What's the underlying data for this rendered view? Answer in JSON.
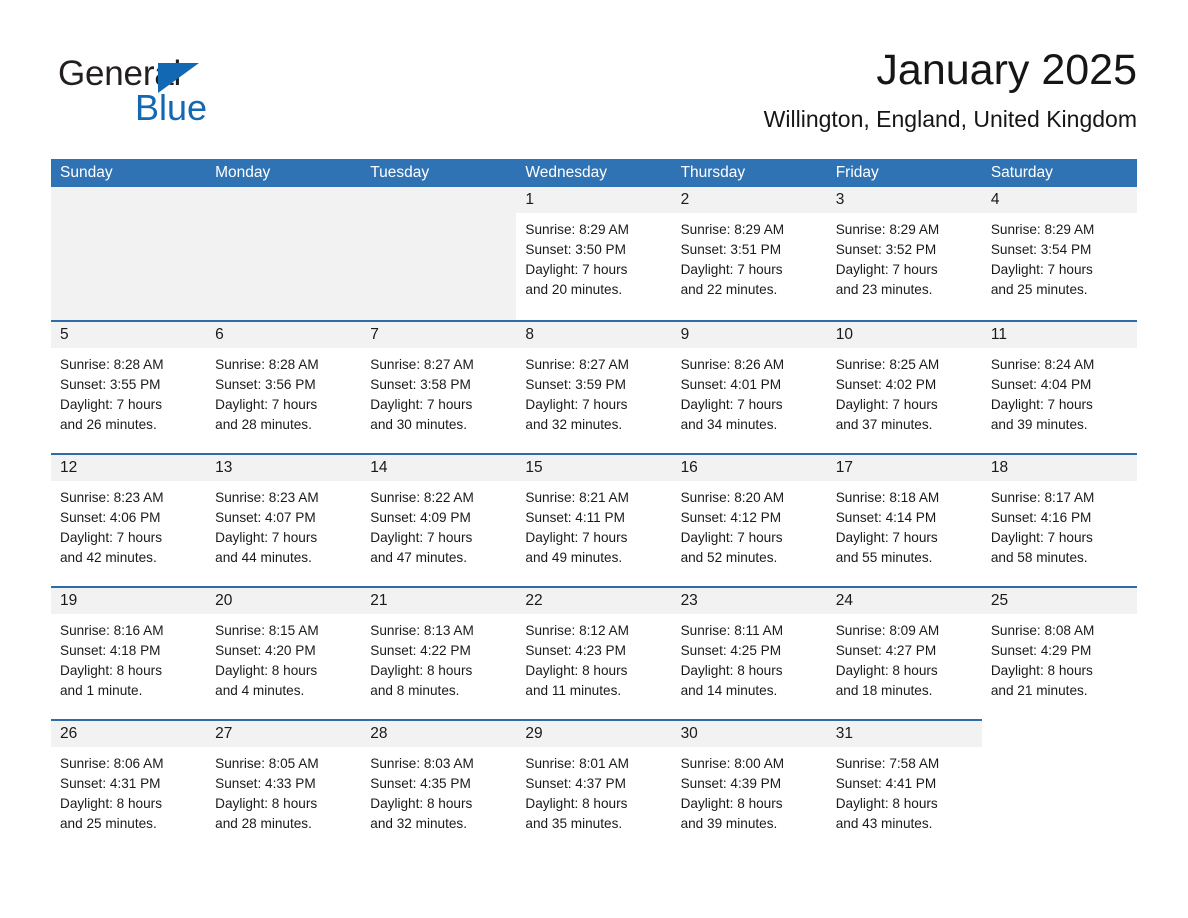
{
  "brand": {
    "name_part1": "General",
    "name_part2": "Blue",
    "accent_color": "#1268b3"
  },
  "header": {
    "month_title": "January 2025",
    "location": "Willington, England, United Kingdom"
  },
  "theme": {
    "header_row_bg": "#3073b5",
    "week_divider": "#2e6ca8",
    "day_band_bg": "#f2f2f2"
  },
  "weekdays": [
    "Sunday",
    "Monday",
    "Tuesday",
    "Wednesday",
    "Thursday",
    "Friday",
    "Saturday"
  ],
  "weeks": [
    [
      {
        "empty": true
      },
      {
        "empty": true
      },
      {
        "empty": true
      },
      {
        "day": "1",
        "sunrise": "Sunrise: 8:29 AM",
        "sunset": "Sunset: 3:50 PM",
        "daylight1": "Daylight: 7 hours",
        "daylight2": "and 20 minutes."
      },
      {
        "day": "2",
        "sunrise": "Sunrise: 8:29 AM",
        "sunset": "Sunset: 3:51 PM",
        "daylight1": "Daylight: 7 hours",
        "daylight2": "and 22 minutes."
      },
      {
        "day": "3",
        "sunrise": "Sunrise: 8:29 AM",
        "sunset": "Sunset: 3:52 PM",
        "daylight1": "Daylight: 7 hours",
        "daylight2": "and 23 minutes."
      },
      {
        "day": "4",
        "sunrise": "Sunrise: 8:29 AM",
        "sunset": "Sunset: 3:54 PM",
        "daylight1": "Daylight: 7 hours",
        "daylight2": "and 25 minutes."
      }
    ],
    [
      {
        "day": "5",
        "sunrise": "Sunrise: 8:28 AM",
        "sunset": "Sunset: 3:55 PM",
        "daylight1": "Daylight: 7 hours",
        "daylight2": "and 26 minutes."
      },
      {
        "day": "6",
        "sunrise": "Sunrise: 8:28 AM",
        "sunset": "Sunset: 3:56 PM",
        "daylight1": "Daylight: 7 hours",
        "daylight2": "and 28 minutes."
      },
      {
        "day": "7",
        "sunrise": "Sunrise: 8:27 AM",
        "sunset": "Sunset: 3:58 PM",
        "daylight1": "Daylight: 7 hours",
        "daylight2": "and 30 minutes."
      },
      {
        "day": "8",
        "sunrise": "Sunrise: 8:27 AM",
        "sunset": "Sunset: 3:59 PM",
        "daylight1": "Daylight: 7 hours",
        "daylight2": "and 32 minutes."
      },
      {
        "day": "9",
        "sunrise": "Sunrise: 8:26 AM",
        "sunset": "Sunset: 4:01 PM",
        "daylight1": "Daylight: 7 hours",
        "daylight2": "and 34 minutes."
      },
      {
        "day": "10",
        "sunrise": "Sunrise: 8:25 AM",
        "sunset": "Sunset: 4:02 PM",
        "daylight1": "Daylight: 7 hours",
        "daylight2": "and 37 minutes."
      },
      {
        "day": "11",
        "sunrise": "Sunrise: 8:24 AM",
        "sunset": "Sunset: 4:04 PM",
        "daylight1": "Daylight: 7 hours",
        "daylight2": "and 39 minutes."
      }
    ],
    [
      {
        "day": "12",
        "sunrise": "Sunrise: 8:23 AM",
        "sunset": "Sunset: 4:06 PM",
        "daylight1": "Daylight: 7 hours",
        "daylight2": "and 42 minutes."
      },
      {
        "day": "13",
        "sunrise": "Sunrise: 8:23 AM",
        "sunset": "Sunset: 4:07 PM",
        "daylight1": "Daylight: 7 hours",
        "daylight2": "and 44 minutes."
      },
      {
        "day": "14",
        "sunrise": "Sunrise: 8:22 AM",
        "sunset": "Sunset: 4:09 PM",
        "daylight1": "Daylight: 7 hours",
        "daylight2": "and 47 minutes."
      },
      {
        "day": "15",
        "sunrise": "Sunrise: 8:21 AM",
        "sunset": "Sunset: 4:11 PM",
        "daylight1": "Daylight: 7 hours",
        "daylight2": "and 49 minutes."
      },
      {
        "day": "16",
        "sunrise": "Sunrise: 8:20 AM",
        "sunset": "Sunset: 4:12 PM",
        "daylight1": "Daylight: 7 hours",
        "daylight2": "and 52 minutes."
      },
      {
        "day": "17",
        "sunrise": "Sunrise: 8:18 AM",
        "sunset": "Sunset: 4:14 PM",
        "daylight1": "Daylight: 7 hours",
        "daylight2": "and 55 minutes."
      },
      {
        "day": "18",
        "sunrise": "Sunrise: 8:17 AM",
        "sunset": "Sunset: 4:16 PM",
        "daylight1": "Daylight: 7 hours",
        "daylight2": "and 58 minutes."
      }
    ],
    [
      {
        "day": "19",
        "sunrise": "Sunrise: 8:16 AM",
        "sunset": "Sunset: 4:18 PM",
        "daylight1": "Daylight: 8 hours",
        "daylight2": "and 1 minute."
      },
      {
        "day": "20",
        "sunrise": "Sunrise: 8:15 AM",
        "sunset": "Sunset: 4:20 PM",
        "daylight1": "Daylight: 8 hours",
        "daylight2": "and 4 minutes."
      },
      {
        "day": "21",
        "sunrise": "Sunrise: 8:13 AM",
        "sunset": "Sunset: 4:22 PM",
        "daylight1": "Daylight: 8 hours",
        "daylight2": "and 8 minutes."
      },
      {
        "day": "22",
        "sunrise": "Sunrise: 8:12 AM",
        "sunset": "Sunset: 4:23 PM",
        "daylight1": "Daylight: 8 hours",
        "daylight2": "and 11 minutes."
      },
      {
        "day": "23",
        "sunrise": "Sunrise: 8:11 AM",
        "sunset": "Sunset: 4:25 PM",
        "daylight1": "Daylight: 8 hours",
        "daylight2": "and 14 minutes."
      },
      {
        "day": "24",
        "sunrise": "Sunrise: 8:09 AM",
        "sunset": "Sunset: 4:27 PM",
        "daylight1": "Daylight: 8 hours",
        "daylight2": "and 18 minutes."
      },
      {
        "day": "25",
        "sunrise": "Sunrise: 8:08 AM",
        "sunset": "Sunset: 4:29 PM",
        "daylight1": "Daylight: 8 hours",
        "daylight2": "and 21 minutes."
      }
    ],
    [
      {
        "day": "26",
        "sunrise": "Sunrise: 8:06 AM",
        "sunset": "Sunset: 4:31 PM",
        "daylight1": "Daylight: 8 hours",
        "daylight2": "and 25 minutes."
      },
      {
        "day": "27",
        "sunrise": "Sunrise: 8:05 AM",
        "sunset": "Sunset: 4:33 PM",
        "daylight1": "Daylight: 8 hours",
        "daylight2": "and 28 minutes."
      },
      {
        "day": "28",
        "sunrise": "Sunrise: 8:03 AM",
        "sunset": "Sunset: 4:35 PM",
        "daylight1": "Daylight: 8 hours",
        "daylight2": "and 32 minutes."
      },
      {
        "day": "29",
        "sunrise": "Sunrise: 8:01 AM",
        "sunset": "Sunset: 4:37 PM",
        "daylight1": "Daylight: 8 hours",
        "daylight2": "and 35 minutes."
      },
      {
        "day": "30",
        "sunrise": "Sunrise: 8:00 AM",
        "sunset": "Sunset: 4:39 PM",
        "daylight1": "Daylight: 8 hours",
        "daylight2": "and 39 minutes."
      },
      {
        "day": "31",
        "sunrise": "Sunrise: 7:58 AM",
        "sunset": "Sunset: 4:41 PM",
        "daylight1": "Daylight: 8 hours",
        "daylight2": "and 43 minutes."
      },
      {
        "empty": true
      }
    ]
  ]
}
